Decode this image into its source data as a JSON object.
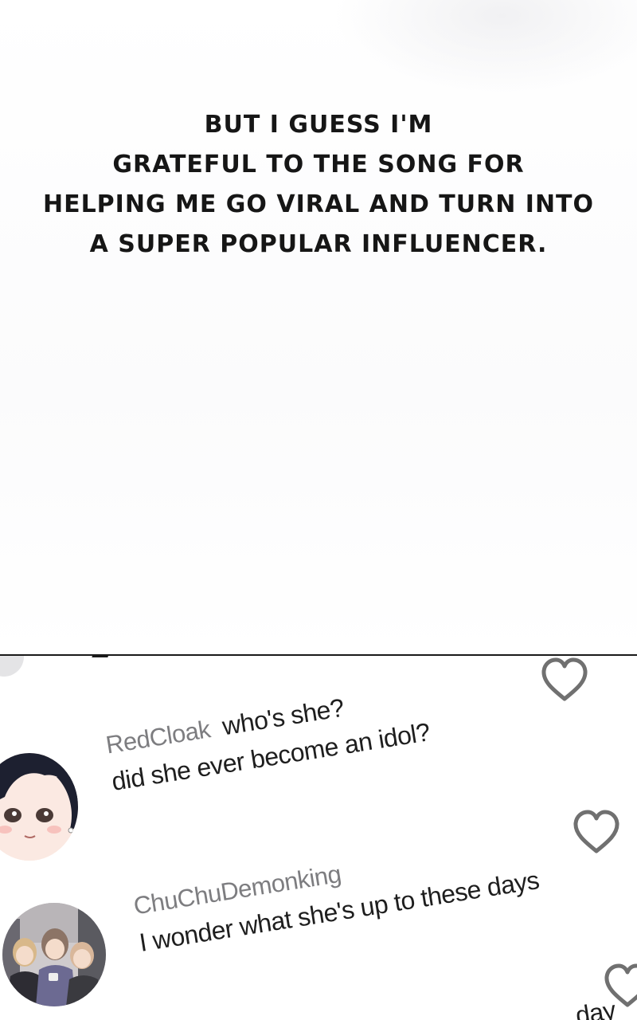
{
  "narration": {
    "lines": [
      "BUT I GUESS I'M",
      "GRATEFUL TO THE SONG FOR",
      "HELPING ME GO VIRAL AND TURN INTO",
      "A SUPER POPULAR INFLUENCER."
    ]
  },
  "comments": [
    {
      "username": "RedCloak",
      "line1": "who's she?",
      "line2": "did she ever become an idol?",
      "avatar": "dark-haired-girl-avatar"
    },
    {
      "username": "ChuChuDemonking",
      "line1": "",
      "line2": "I wonder what she's up to these days",
      "avatar": "group-of-three-avatar"
    },
    {
      "username": "",
      "line1": "day",
      "line2": ""
    }
  ],
  "icons": [
    "heart-icon",
    "heart-icon",
    "heart-icon"
  ],
  "colors": {
    "text": "#161616",
    "username": "#7d7d80",
    "divider": "#1a1a1a",
    "heart": "#707070"
  }
}
